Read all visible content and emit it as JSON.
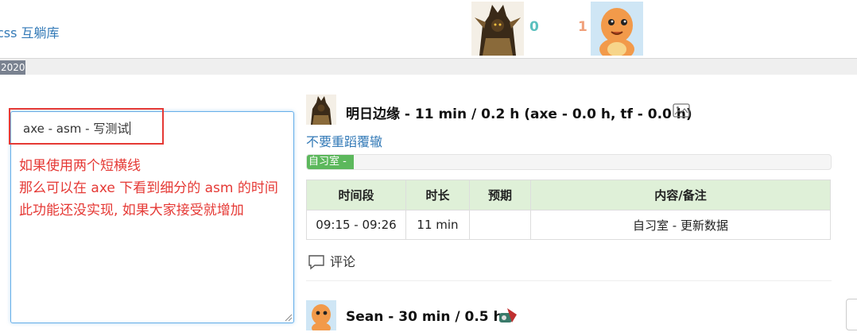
{
  "navbar": {
    "brand": "css 互躺库",
    "team_left_score": "0",
    "team_right_score": "1",
    "colors": {
      "left_score": "#5bc0be",
      "right_score": "#f0a07a"
    }
  },
  "year_badge": "2020",
  "editor": {
    "value": "axe - asm - 写测试"
  },
  "annotation": {
    "line1": "如果使用两个短横线",
    "line2": "那么可以在 axe 下看到细分的 asm 的时间",
    "line3": "此功能还没实现, 如果大家接受就增加"
  },
  "entry1": {
    "title": "明日边缘 - 11 min / 0.2 h (axe - 0.0 h, tf - 0.0 h)",
    "link": "不要重蹈覆辙",
    "progress_label": "自习室 -",
    "progress_fraction": 0.09,
    "table": {
      "headers": [
        "时间段",
        "时长",
        "预期",
        "内容/备注"
      ],
      "rows": [
        [
          "09:15 - 09:26",
          "11 min",
          "",
          "自习室 - 更新数据"
        ]
      ]
    },
    "comment_label": "评论"
  },
  "entry2": {
    "title": "Sean - 30 min / 0.5 h"
  }
}
